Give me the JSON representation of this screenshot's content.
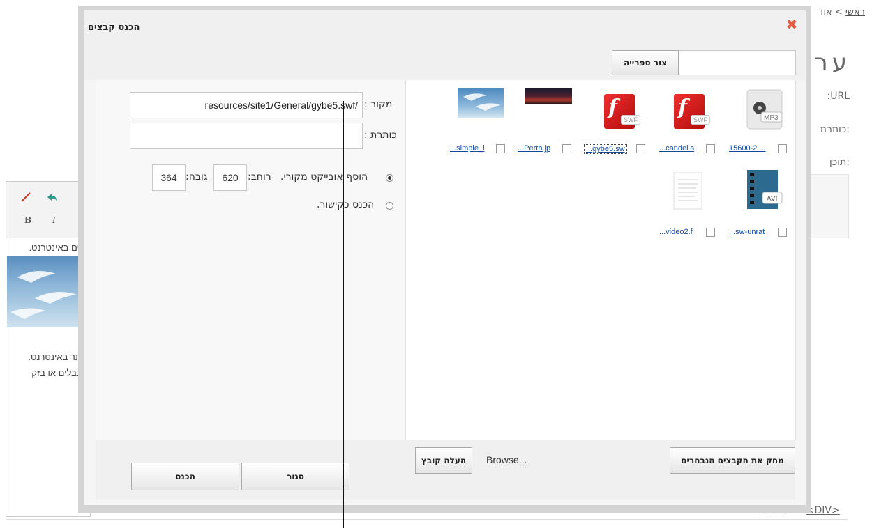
{
  "background": {
    "breadcrumb_link": "ראשי",
    "breadcrumb_rest": "> אוד",
    "page_title": "ערו",
    "label_url": ":URL",
    "label_title": "כותרת:",
    "label_content": "תוכן:",
    "editor_text_1": "קיים באינטרנט.",
    "editor_text_2": "אתר באינטרנט.",
    "editor_text_3": "הכבלים או בזק",
    "bottom_tag_1": "<BODY>",
    "bottom_tag_2": "<DIV>"
  },
  "dialog": {
    "title": "הכנס קבצים",
    "library_button": "צור ספרייה",
    "library_input_value": "",
    "source_label": "מקור :",
    "source_value": "resources/site1/General/gybe5.swf/",
    "title_label": "כותרת :",
    "title_value": "",
    "radio_embed_label": "הוסף אובייקט מקורי.",
    "width_label": "רוחב:",
    "width_value": "620",
    "height_label": "גובה:",
    "height_value": "364",
    "radio_link_label": "הכנס כקישור.",
    "files": [
      {
        "name": "15600-2....",
        "type": "mp3"
      },
      {
        "name": "...candel.s",
        "type": "swf"
      },
      {
        "name": "...gybe5.sw",
        "type": "swf"
      },
      {
        "name": "...Perth.jp",
        "type": "image-perth"
      },
      {
        "name": "...simple_i",
        "type": "image-birds"
      },
      {
        "name": "...sw-unrat",
        "type": "avi"
      },
      {
        "name": "...video2.f",
        "type": "doc"
      }
    ],
    "delete_button": "מחק את הקבצים הנבחרים",
    "browse_label": "Browse...",
    "upload_button": "העלה קובץ",
    "close_button": "סגור",
    "insert_button": "הכנס"
  },
  "icons": {
    "close": "close-icon",
    "mp3": "mp3-file-icon",
    "swf": "flash-swf-icon",
    "avi": "avi-video-icon",
    "doc": "document-icon"
  },
  "colors": {
    "close_icon": "#e45a45",
    "link_blue": "#124a9c",
    "flash_red": "#d81f1f"
  }
}
